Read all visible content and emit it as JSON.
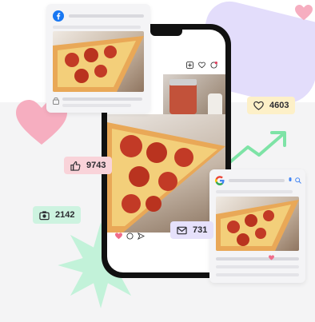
{
  "colors": {
    "heart_pink": "#f6aec0",
    "starburst_green": "#c2f2d9",
    "blob_purple": "#e3ddfb",
    "arrow_green": "#7ee3a6",
    "facebook_blue": "#1877f2",
    "notification_red": "#e4405f"
  },
  "icons": {
    "facebook": "facebook-logo-icon",
    "google": "google-logo-icon",
    "heart": "heart-icon",
    "like": "thumbs-up-icon",
    "camera": "camera-icon",
    "mail": "mail-icon"
  },
  "stats": {
    "hearts": "4603",
    "likes": "9743",
    "photos": "2142",
    "messages": "731"
  }
}
